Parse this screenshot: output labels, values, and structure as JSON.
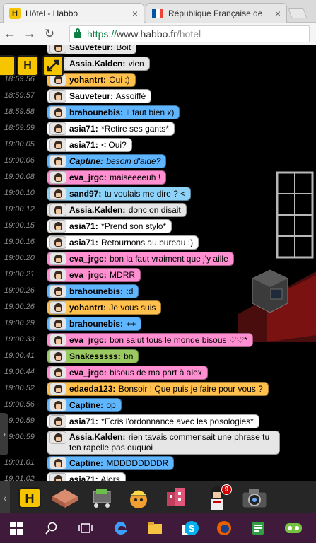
{
  "browser": {
    "tabs": [
      {
        "title": "Hôtel - Habbo",
        "favicon": "H",
        "active": true
      },
      {
        "title": "République Française de",
        "favicon": "flag-fr",
        "active": false
      }
    ],
    "url_scheme": "https://",
    "url_host": "www.habbo.fr",
    "url_path": "/hotel"
  },
  "chat": [
    {
      "time": "",
      "user": "Sauveteur:",
      "msg": "Boit",
      "color": "#e6e6e6",
      "italic": false
    },
    {
      "time": "",
      "user": "Assia.Kalden:",
      "msg": "vien",
      "color": "#e6e6e6",
      "italic": false
    },
    {
      "time": "18:59:56",
      "user": "yohantrt:",
      "msg": "Oui :)",
      "color": "#ffc04d",
      "italic": false
    },
    {
      "time": "18:59:57",
      "user": "Sauveteur:",
      "msg": "Assoiffé",
      "color": "#ffffff",
      "italic": false
    },
    {
      "time": "18:59:58",
      "user": "brahounebis:",
      "msg": "il faut bien x)",
      "color": "#5fb6ff",
      "italic": false
    },
    {
      "time": "18:59:59",
      "user": "asia71:",
      "msg": "*Retire ses gants*",
      "color": "#ffffff",
      "italic": false
    },
    {
      "time": "19:00:05",
      "user": "asia71:",
      "msg": "< Oui?",
      "color": "#ffffff",
      "italic": false
    },
    {
      "time": "19:00:06",
      "user": "Captine:",
      "msg": "besoin d'aide?",
      "color": "#5fb6ff",
      "italic": true
    },
    {
      "time": "19:00:08",
      "user": "eva_jrgc:",
      "msg": "maiseeeeuh !",
      "color": "#ff8fd1",
      "italic": false
    },
    {
      "time": "19:00:10",
      "user": "sand97:",
      "msg": "tu voulais me dire ? <",
      "color": "#8ed3f7",
      "italic": false
    },
    {
      "time": "19:00:12",
      "user": "Assia.Kalden:",
      "msg": "donc on disait",
      "color": "#e6e6e6",
      "italic": false
    },
    {
      "time": "19:00:15",
      "user": "asia71:",
      "msg": "*Prend son stylo*",
      "color": "#ffffff",
      "italic": false
    },
    {
      "time": "19:00:16",
      "user": "asia71:",
      "msg": "Retournons au bureau :)",
      "color": "#ffffff",
      "italic": false
    },
    {
      "time": "19:00:20",
      "user": "eva_jrgc:",
      "msg": "bon la faut vraiment que j'y aille",
      "color": "#ff8fd1",
      "italic": false
    },
    {
      "time": "19:00:21",
      "user": "eva_jrgc:",
      "msg": "MDRR",
      "color": "#ff8fd1",
      "italic": false
    },
    {
      "time": "19:00:26",
      "user": "brahounebis:",
      "msg": ":d",
      "color": "#5fb6ff",
      "italic": false
    },
    {
      "time": "19:00:26",
      "user": "yohantrt:",
      "msg": "Je vous suis",
      "color": "#ffc04d",
      "italic": false
    },
    {
      "time": "19:00:29",
      "user": "brahounebis:",
      "msg": "++",
      "color": "#5fb6ff",
      "italic": false
    },
    {
      "time": "19:00:33",
      "user": "eva_jrgc:",
      "msg": "bon salut tous le monde bisous ♡♡*",
      "color": "#ff8fd1",
      "italic": false
    },
    {
      "time": "19:00:41",
      "user": "Snakesssss:",
      "msg": "bn",
      "color": "#9ac961",
      "italic": false
    },
    {
      "time": "19:00:44",
      "user": "eva_jrgc:",
      "msg": "bisous de ma part à alex",
      "color": "#ff8fd1",
      "italic": false
    },
    {
      "time": "19:00:52",
      "user": "edaeda123:",
      "msg": "Bonsoir ! Que puis je faire pour vous ?",
      "color": "#ffc04d",
      "italic": false
    },
    {
      "time": "19:00:56",
      "user": "Captine:",
      "msg": "op",
      "color": "#5fb6ff",
      "italic": false
    },
    {
      "time": "19:00:59",
      "user": "asia71:",
      "msg": "*Ecris l'ordonnance avec les posologies*",
      "color": "#ffffff",
      "italic": false
    },
    {
      "time": "19:00:59",
      "user": "Assia.Kalden:",
      "msg": "rien tavais commensait une phrase tu ten rapelle pas ouquoi",
      "color": "#e6e6e6",
      "italic": false,
      "tall": true
    },
    {
      "time": "19:01:01",
      "user": "Captine:",
      "msg": "MDDDDDDDDR",
      "color": "#5fb6ff",
      "italic": false
    },
    {
      "time": "19:01:02",
      "user": "asia71:",
      "msg": "Alors",
      "color": "#ffffff",
      "italic": false
    }
  ],
  "controls": {
    "left_button_label": "H",
    "expand_icon": "expand-icon"
  },
  "toolbar": {
    "badge_count": "9",
    "icons": [
      "habbo-logo-icon",
      "rooms-icon",
      "shop-icon",
      "builder-icon",
      "catalog-icon",
      "avatar-icon",
      "camera-icon"
    ]
  },
  "taskbar": {
    "icons": [
      "windows-start-icon",
      "search-icon",
      "task-view-icon",
      "edge-icon",
      "explorer-icon",
      "store-icon",
      "skype-icon",
      "firefox-icon",
      "notes-icon",
      "game-icon"
    ]
  }
}
